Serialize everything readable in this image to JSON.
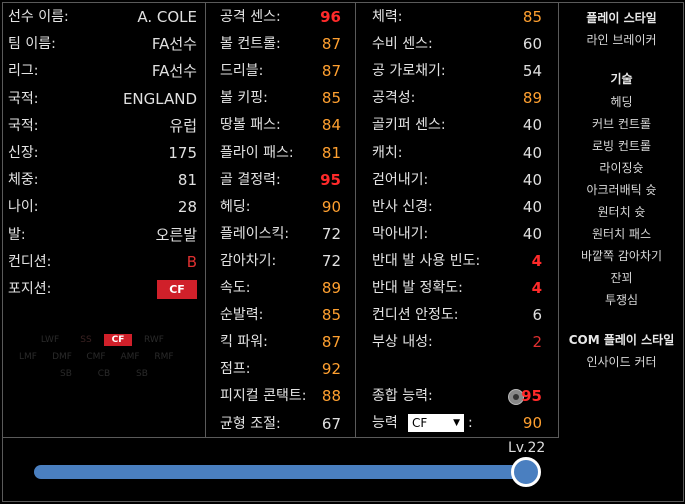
{
  "profile": [
    {
      "label": "선수 이름:",
      "value": "A. COLE"
    },
    {
      "label": "팀 이름:",
      "value": "FA선수"
    },
    {
      "label": "리그:",
      "value": "FA선수"
    },
    {
      "label": "국적:",
      "value": "ENGLAND"
    },
    {
      "label": "국적:",
      "value": "유럽"
    },
    {
      "label": "신장:",
      "value": "175"
    },
    {
      "label": "체중:",
      "value": "81"
    },
    {
      "label": "나이:",
      "value": "28"
    },
    {
      "label": "발:",
      "value": "오른발"
    },
    {
      "label": "컨디션:",
      "value": "B"
    },
    {
      "label": "포지션:",
      "value": "CF"
    }
  ],
  "position_grid": {
    "row1": [
      "SS",
      "CF"
    ],
    "row2": [
      "LWF",
      "RWF"
    ],
    "row3": [
      "LMF",
      "DMF",
      "CMF",
      "AMF",
      "RMF"
    ],
    "row4": [
      "SB",
      "CB",
      "SB"
    ]
  },
  "stats_col2": [
    {
      "label": "공격 센스:",
      "value": "96",
      "color": "red"
    },
    {
      "label": "볼 컨트롤:",
      "value": "87",
      "color": "orange"
    },
    {
      "label": "드리블:",
      "value": "87",
      "color": "orange"
    },
    {
      "label": "볼 키핑:",
      "value": "85",
      "color": "orange"
    },
    {
      "label": "땅볼 패스:",
      "value": "84",
      "color": "orange"
    },
    {
      "label": "플라이 패스:",
      "value": "81",
      "color": "orange"
    },
    {
      "label": "골 결정력:",
      "value": "95",
      "color": "red"
    },
    {
      "label": "헤딩:",
      "value": "90",
      "color": "orange"
    },
    {
      "label": "플레이스킥:",
      "value": "72",
      "color": "white"
    },
    {
      "label": "감아차기:",
      "value": "72",
      "color": "white"
    },
    {
      "label": "속도:",
      "value": "89",
      "color": "orange"
    },
    {
      "label": "순발력:",
      "value": "85",
      "color": "orange"
    },
    {
      "label": "킥 파워:",
      "value": "87",
      "color": "orange"
    },
    {
      "label": "점프:",
      "value": "92",
      "color": "orange"
    },
    {
      "label": "피지컬 콘택트:",
      "value": "88",
      "color": "orange"
    },
    {
      "label": "균형 조절:",
      "value": "67",
      "color": "white"
    }
  ],
  "stats_col3": [
    {
      "label": "체력:",
      "value": "85",
      "color": "orange"
    },
    {
      "label": "수비 센스:",
      "value": "60",
      "color": "white"
    },
    {
      "label": "공 가로채기:",
      "value": "54",
      "color": "white"
    },
    {
      "label": "공격성:",
      "value": "89",
      "color": "orange"
    },
    {
      "label": "골키퍼 센스:",
      "value": "40",
      "color": "white"
    },
    {
      "label": "캐치:",
      "value": "40",
      "color": "white"
    },
    {
      "label": "걷어내기:",
      "value": "40",
      "color": "white"
    },
    {
      "label": "반사 신경:",
      "value": "40",
      "color": "white"
    },
    {
      "label": "막아내기:",
      "value": "40",
      "color": "white"
    },
    {
      "label": "반대 발 사용 빈도:",
      "value": "4",
      "color": "red"
    },
    {
      "label": "반대 발 정확도:",
      "value": "4",
      "color": "red"
    },
    {
      "label": "컨디션 안정도:",
      "value": "6",
      "color": "white"
    },
    {
      "label": "부상 내성:",
      "value": "2",
      "color": "dred"
    }
  ],
  "overall": {
    "label": "종합 능력:",
    "value": "95",
    "pos_label": "능력",
    "pos_value": "CF",
    "pos_suffix": ":",
    "pos_rating": "90"
  },
  "side": {
    "playstyle_title": "플레이 스타일",
    "playstyle": "라인 브레이커",
    "skills_title": "기술",
    "skills": [
      "헤딩",
      "커브 컨트롤",
      "로빙 컨트롤",
      "라이징슛",
      "아크러배틱 슛",
      "원터치 슛",
      "원터치 패스",
      "바깥쪽 감아차기",
      "잔꾀",
      "투쟁심"
    ],
    "com_title": "COM 플레이 스타일",
    "com": "인사이드 커터"
  },
  "level": {
    "label": "Lv.22",
    "fraction": 1.0
  },
  "colors": {
    "accent": "#4a7fc0",
    "red": "#ff2a2a",
    "orange": "#ffa030",
    "badge": "#d0202a"
  }
}
